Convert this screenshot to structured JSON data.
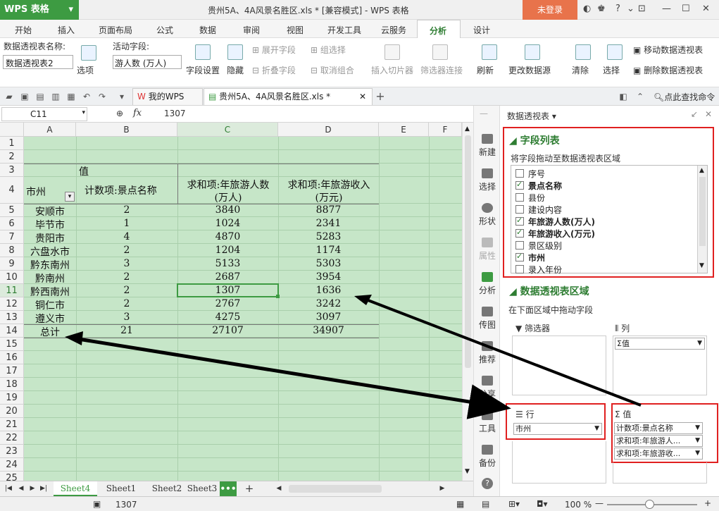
{
  "app": {
    "name": "WPS 表格",
    "doc_title": "贵州5A、4A风景名胜区.xls * [兼容模式] - WPS 表格",
    "login": "未登录"
  },
  "menu": [
    "开始",
    "插入",
    "页面布局",
    "公式",
    "数据",
    "审阅",
    "视图",
    "开发工具",
    "云服务",
    "分析",
    "设计"
  ],
  "ribbon": {
    "pivot_name_label": "数据透视表名称:",
    "pivot_name_value": "数据透视表2",
    "options": "选项",
    "active_field_label": "活动字段:",
    "active_field_value": "游人数 (万人)",
    "field_settings": "字段设置",
    "hide": "隐藏",
    "expand": "展开字段",
    "collapse": "折叠字段",
    "group_select": "组选择",
    "ungroup": "取消组合",
    "insert_slicer": "插入切片器",
    "filter_conn": "筛选器连接",
    "refresh": "刷新",
    "change_source": "更改数据源",
    "clear": "清除",
    "select": "选择",
    "move_pivot": "移动数据透视表",
    "delete_pivot": "删除数据透视表"
  },
  "tabs": {
    "mywps": "我的WPS",
    "doc": "贵州5A、4A风景名胜区.xls *",
    "find_cmd": "点此查找命令"
  },
  "formula": {
    "cell_ref": "C11",
    "fx": "fx",
    "value": "1307"
  },
  "sheet": {
    "columns": [
      "A",
      "B",
      "C",
      "D",
      "E",
      "F"
    ],
    "rows": [
      "1",
      "2",
      "3",
      "4",
      "5",
      "6",
      "7",
      "8",
      "9",
      "10",
      "11",
      "12",
      "13",
      "14",
      "15",
      "16",
      "17",
      "18",
      "19",
      "20",
      "21",
      "22",
      "23",
      "24",
      "25"
    ],
    "values_header": "值",
    "h_city": "市州",
    "h_count": "计数项:景点名称",
    "h_tourist_1": "求和项:年旅游人数",
    "h_tourist_2": "(万人)",
    "h_income_1": "求和项:年旅游收入",
    "h_income_2": "(万元)",
    "data": [
      [
        "安顺市",
        "2",
        "3840",
        "8877"
      ],
      [
        "毕节市",
        "1",
        "1024",
        "2341"
      ],
      [
        "贵阳市",
        "4",
        "4870",
        "5283"
      ],
      [
        "六盘水市",
        "2",
        "1204",
        "1174"
      ],
      [
        "黔东南州",
        "3",
        "5133",
        "5303"
      ],
      [
        "黔南州",
        "2",
        "2687",
        "3954"
      ],
      [
        "黔西南州",
        "2",
        "1307",
        "1636"
      ],
      [
        "铜仁市",
        "2",
        "2767",
        "3242"
      ],
      [
        "遵义市",
        "3",
        "4275",
        "3097"
      ]
    ],
    "total": [
      "总计",
      "21",
      "27107",
      "34907"
    ]
  },
  "sheet_tabs": [
    "Sheet4",
    "Sheet1",
    "Sheet2",
    "Sheet3"
  ],
  "status": {
    "value": "1307",
    "zoom": "100 %"
  },
  "side_tools": [
    "新建",
    "选择",
    "形状",
    "属性",
    "分析",
    "传图",
    "推荐",
    "分享",
    "工具",
    "备份"
  ],
  "panel": {
    "title": "数据透视表",
    "field_list_title": "字段列表",
    "field_hint": "将字段拖动至数据透视表区域",
    "fields": [
      {
        "name": "序号",
        "checked": false
      },
      {
        "name": "景点名称",
        "checked": true
      },
      {
        "name": "县份",
        "checked": false
      },
      {
        "name": "建设内容",
        "checked": false
      },
      {
        "name": "年旅游人数(万人)",
        "checked": true
      },
      {
        "name": "年旅游收入(万元)",
        "checked": true
      },
      {
        "name": "景区级别",
        "checked": false
      },
      {
        "name": "市州",
        "checked": true
      },
      {
        "name": "录入年份",
        "checked": false
      }
    ],
    "area_title": "数据透视表区域",
    "area_hint": "在下面区域中拖动字段",
    "filter_label": "筛选器",
    "col_label": "列",
    "col_value": "Σ值",
    "row_label": "行",
    "row_value": "市州",
    "val_label": "值",
    "val_items": [
      "计数项:景点名称",
      "求和项:年旅游人...",
      "求和项:年旅游收..."
    ]
  },
  "colors": {
    "accent_green": "#3d9b42",
    "sheet_bg": "#c6e6c8",
    "highlight_red": "#e02020",
    "login_orange": "#e8734b"
  }
}
